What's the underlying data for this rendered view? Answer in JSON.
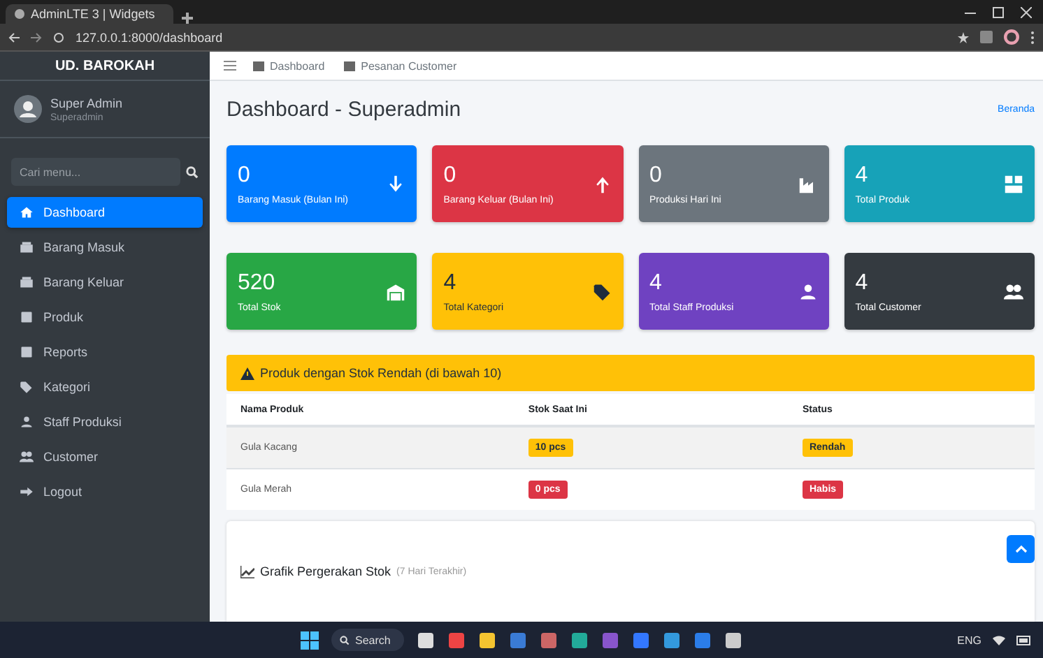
{
  "browser": {
    "tab_title": "AdminLTE 3 | Widgets",
    "url": "127.0.0.1:8000/dashboard"
  },
  "sidebar": {
    "brand": "UD. BAROKAH",
    "user": {
      "name": "Super Admin",
      "role": "Superadmin"
    },
    "search": {
      "placeholder": "Cari menu..."
    },
    "items": [
      {
        "label": "Dashboard",
        "kind": "home",
        "selected": true
      },
      {
        "label": "Barang Masuk",
        "kind": "box",
        "selected": false
      },
      {
        "label": "Barang Keluar",
        "kind": "box",
        "selected": false
      },
      {
        "label": "Produk",
        "kind": "list",
        "selected": false
      },
      {
        "label": "Reports",
        "kind": "list",
        "selected": false
      },
      {
        "label": "Kategori",
        "kind": "tag",
        "selected": false
      },
      {
        "label": "Staff Produksi",
        "kind": "staff",
        "selected": false
      },
      {
        "label": "Customer",
        "kind": "users",
        "selected": false
      },
      {
        "label": "Logout",
        "kind": "logout",
        "selected": false
      }
    ]
  },
  "navbar": {
    "links": [
      {
        "label": "Dashboard"
      },
      {
        "label": "Pesanan Customer"
      }
    ]
  },
  "page": {
    "title": "Dashboard - Superadmin",
    "breadcrumb": "Beranda"
  },
  "cards": [
    {
      "value": "0",
      "label": "Barang Masuk (Bulan Ini)",
      "color": "#007bff",
      "kind": "arrow-down"
    },
    {
      "value": "0",
      "label": "Barang Keluar (Bulan Ini)",
      "color": "#dc3545",
      "kind": "arrow-up"
    },
    {
      "value": "0",
      "label": "Produksi Hari Ini",
      "color": "#6c757d",
      "kind": "industry"
    },
    {
      "value": "4",
      "label": "Total Produk",
      "color": "#17a2b8",
      "kind": "boxes"
    },
    {
      "value": "520",
      "label": "Total Stok",
      "color": "#28a745",
      "kind": "warehouse"
    },
    {
      "value": "4",
      "label": "Total Kategori",
      "color": "#ffc107",
      "kind": "tag"
    },
    {
      "value": "4",
      "label": "Total Staff Produksi",
      "color": "#6f42c1",
      "kind": "staff"
    },
    {
      "value": "4",
      "label": "Total Customer",
      "color": "#343a40",
      "kind": "users"
    }
  ],
  "low_stock": {
    "title": "Produk dengan Stok Rendah (di bawah 10)",
    "columns": [
      "Nama Produk",
      "Stok Saat Ini",
      "Status"
    ],
    "rows": [
      {
        "name": "Gula Kacang",
        "stock": "10 pcs",
        "status": "Rendah",
        "kind": "warning"
      },
      {
        "name": "Gula Merah",
        "stock": "0 pcs",
        "status": "Habis",
        "kind": "danger"
      }
    ]
  },
  "chart_card": {
    "title": "Grafik Pergerakan Stok",
    "subtitle": "(7 Hari Terakhir)"
  },
  "taskbar": {
    "search": "Search",
    "language": "ENG"
  }
}
